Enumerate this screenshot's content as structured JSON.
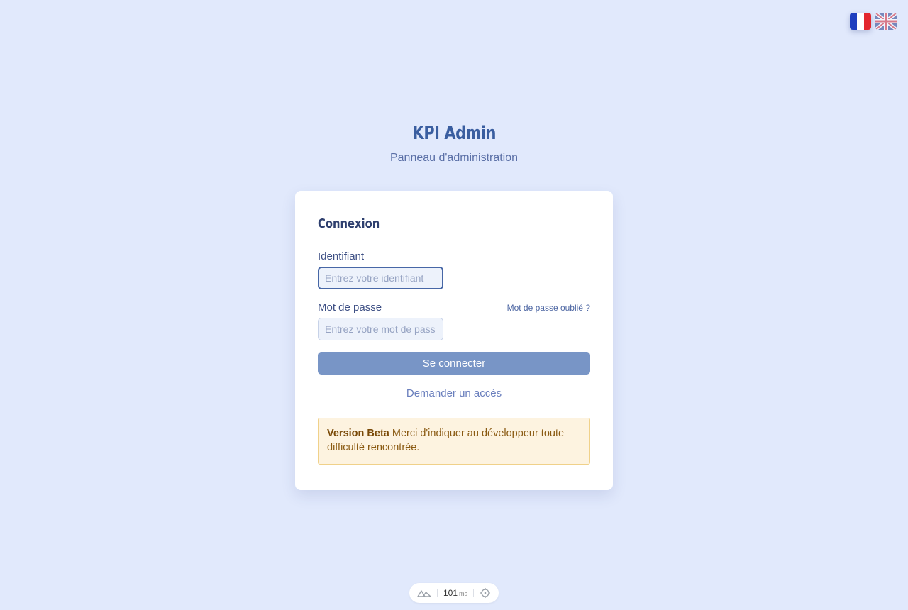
{
  "languages": [
    {
      "code": "fr",
      "icon": "flag-france-icon",
      "active": true
    },
    {
      "code": "en",
      "icon": "flag-uk-icon",
      "active": false
    }
  ],
  "brand": {
    "title": "KPI Admin",
    "subtitle": "Panneau d'administration"
  },
  "login": {
    "title": "Connexion",
    "username_label": "Identifiant",
    "username_placeholder": "Entrez votre identifiant",
    "username_value": "",
    "password_label": "Mot de passe",
    "password_placeholder": "Entrez votre mot de passe",
    "password_value": "",
    "forgot_label": "Mot de passe oublié ?",
    "submit_label": "Se connecter",
    "request_access_label": "Demander un accès"
  },
  "beta_notice": {
    "title": "Version Beta",
    "message": "Merci d'indiquer au développeur toute difficulté rencontrée."
  },
  "devtools": {
    "render_time": "101",
    "unit": "ms",
    "icons": [
      "nuxt-logo-icon",
      "crosshair-icon"
    ]
  },
  "colors": {
    "background": "#e1e9fc",
    "brand": "#3a5ea0",
    "button": "#7895c6",
    "alert_bg": "#fdf3e0",
    "alert_border": "#f0d18a"
  }
}
